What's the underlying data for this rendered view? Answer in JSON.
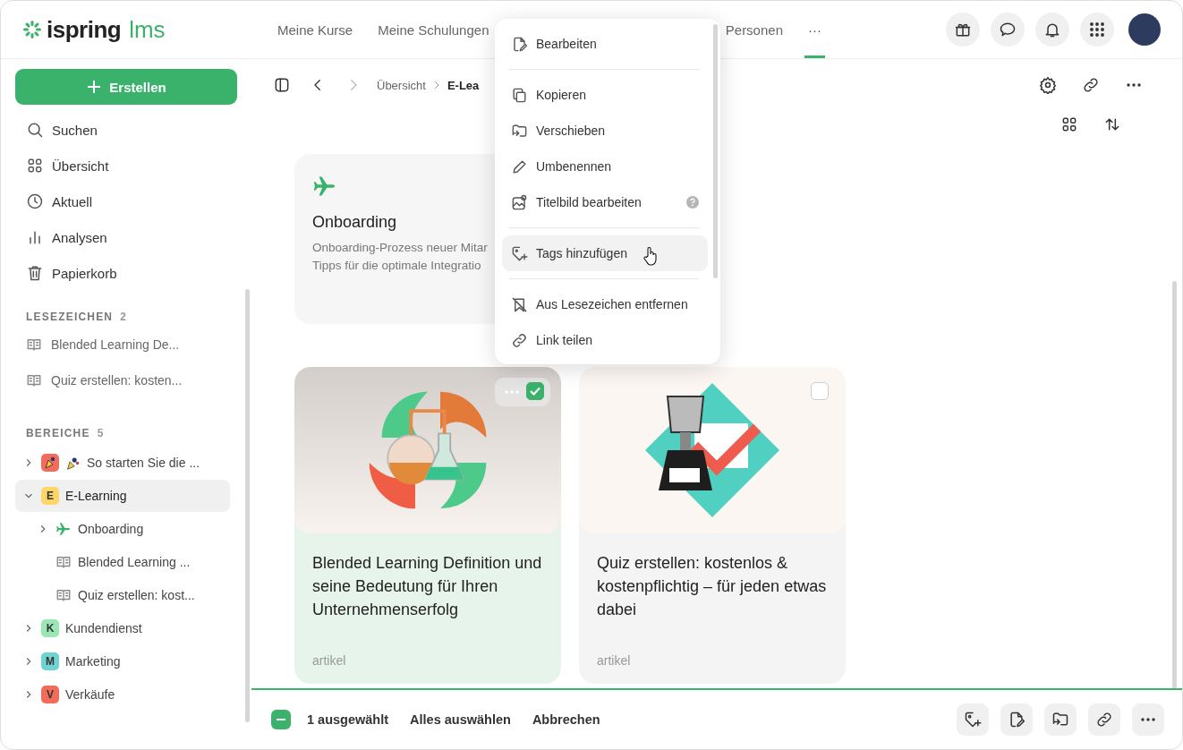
{
  "header": {
    "logo": {
      "brand": "ispring",
      "product": "lms"
    },
    "nav": [
      {
        "label": "Meine Kurse",
        "selected": false
      },
      {
        "label": "Meine Schulungen",
        "selected": false
      },
      {
        "label": "Personen",
        "selected": false
      },
      {
        "label": "···",
        "selected": true
      }
    ]
  },
  "sidebar": {
    "create_button": "Erstellen",
    "nav": [
      {
        "label": "Suchen"
      },
      {
        "label": "Übersicht"
      },
      {
        "label": "Aktuell"
      },
      {
        "label": "Analysen"
      },
      {
        "label": "Papierkorb"
      }
    ],
    "bookmarks": {
      "title": "LESEZEICHEN",
      "count": "2",
      "items": [
        {
          "label": "Blended Learning De..."
        },
        {
          "label": "Quiz erstellen: kosten..."
        }
      ]
    },
    "spaces": {
      "title": "BEREICHE",
      "count": "5",
      "tree": [
        {
          "kind": "space",
          "label": "So starten Sie die ...",
          "color": "#f26b5b",
          "expanded": false,
          "selected": false
        },
        {
          "kind": "space",
          "label": "E-Learning",
          "badge": "E",
          "color": "#fcd667",
          "expanded": true,
          "selected": true,
          "children": [
            {
              "kind": "folder",
              "label": "Onboarding",
              "expanded": false,
              "selected": false
            },
            {
              "kind": "article",
              "label": "Blended Learning ...",
              "selected": false
            },
            {
              "kind": "article",
              "label": "Quiz erstellen: kost...",
              "selected": false
            }
          ]
        },
        {
          "kind": "space",
          "label": "Kundendienst",
          "badge": "K",
          "color": "#9ae6b4",
          "expanded": false,
          "selected": false
        },
        {
          "kind": "space",
          "label": "Marketing",
          "badge": "M",
          "color": "#6fd3d1",
          "expanded": false,
          "selected": false
        },
        {
          "kind": "space",
          "label": "Verkäufe",
          "badge": "V",
          "color": "#f26b5b",
          "expanded": false,
          "selected": false
        }
      ]
    }
  },
  "toolbar": {
    "back": {
      "disabled": false
    },
    "forward": {
      "disabled": true
    },
    "breadcrumb": [
      "Übersicht",
      "E-Lea"
    ]
  },
  "folder_card": {
    "title": "Onboarding",
    "description_lines": [
      "Onboarding-Prozess neuer Mitar",
      "Tipps für die optimale Integratio"
    ]
  },
  "cards": [
    {
      "kind": "flasks",
      "title": "Blended Learning Definition und seine Bedeutung für Ihren Unternehmenserfolg",
      "type": "artikel",
      "selected": true,
      "hovered": true
    },
    {
      "kind": "trophy",
      "title": "Quiz erstellen: kostenlos & kostenpflichtig – für jeden etwas dabei",
      "type": "artikel",
      "selected": false,
      "hovered": false
    }
  ],
  "context_menu": {
    "groups": [
      [
        {
          "label": "Bearbeiten",
          "help": false,
          "hovered": false
        }
      ],
      [
        {
          "label": "Kopieren",
          "help": false,
          "hovered": false
        },
        {
          "label": "Verschieben",
          "help": false,
          "hovered": false
        },
        {
          "label": "Umbenennen",
          "help": false,
          "hovered": false
        },
        {
          "label": "Titelbild bearbeiten",
          "help": true,
          "hovered": false
        }
      ],
      [
        {
          "label": "Tags hinzufügen",
          "help": false,
          "hovered": true
        }
      ],
      [
        {
          "label": "Aus Lesezeichen entfernen",
          "help": false,
          "hovered": false
        },
        {
          "label": "Link teilen",
          "help": false,
          "hovered": false
        }
      ]
    ]
  },
  "selection_bar": {
    "checked": true,
    "indeterminate": true,
    "count_label": "1 ausgewählt",
    "select_all": "Alles auswählen",
    "cancel": "Abbrechen"
  }
}
